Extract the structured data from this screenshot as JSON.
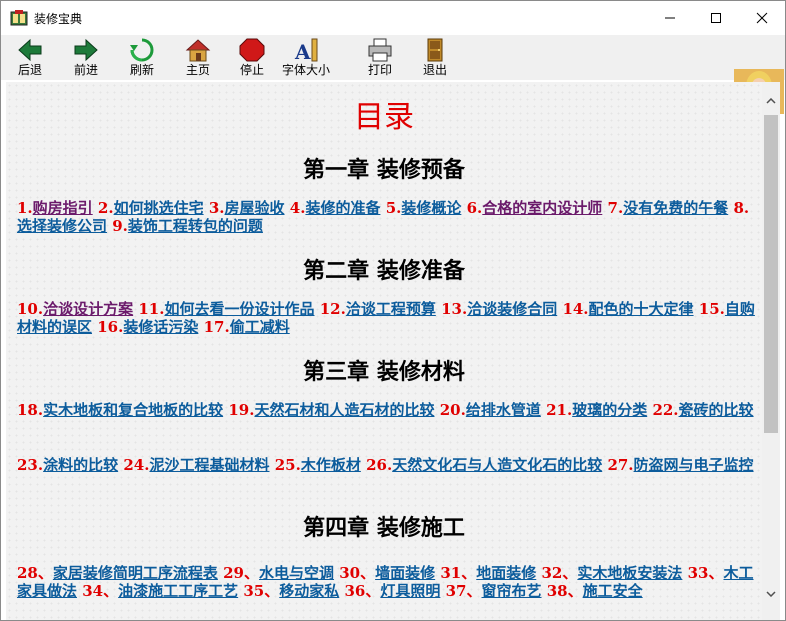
{
  "window": {
    "title": "装修宝典",
    "minimize_icon": "minimize-icon",
    "maximize_icon": "maximize-icon",
    "close_icon": "close-icon"
  },
  "toolbar": {
    "back": "后退",
    "forward": "前进",
    "refresh": "刷新",
    "home": "主页",
    "stop": "停止",
    "font_size": "字体大小",
    "print": "打印",
    "exit": "退出"
  },
  "colors": {
    "link": "#0c5c9c",
    "visited_link": "#6b1a6b",
    "number": "#e00000",
    "title": "#e00000"
  },
  "content": {
    "title": "目录",
    "chapters": [
      {
        "heading": "第一章 装修预备",
        "items": [
          {
            "num": "1.",
            "text": "购房指引",
            "visited": true
          },
          {
            "num": "2.",
            "text": "如何挑选住宅",
            "visited": false
          },
          {
            "num": "3.",
            "text": "房屋验收",
            "visited": false
          },
          {
            "num": "4.",
            "text": "装修的准备",
            "visited": false
          },
          {
            "num": "5.",
            "text": "装修概论",
            "visited": false
          },
          {
            "num": "6.",
            "text": "合格的室内设计师",
            "visited": true
          },
          {
            "num": "7.",
            "text": "没有免费的午餐",
            "visited": false
          },
          {
            "num": "8.",
            "text": "选择装修公司",
            "visited": false
          },
          {
            "num": "9.",
            "text": "装饰工程转包的问题",
            "visited": false
          }
        ]
      },
      {
        "heading": "第二章 装修准备",
        "items": [
          {
            "num": "10.",
            "text": "洽谈设计方案",
            "visited": true
          },
          {
            "num": "11.",
            "text": "如何去看一份设计作品",
            "visited": false
          },
          {
            "num": "12.",
            "text": "洽谈工程预算",
            "visited": false
          },
          {
            "num": "13.",
            "text": "洽谈装修合同",
            "visited": false
          },
          {
            "num": "14.",
            "text": "配色的十大定律",
            "visited": false
          },
          {
            "num": "15.",
            "text": "自购材料的误区",
            "visited": false
          },
          {
            "num": "16.",
            "text": "装修话污染",
            "visited": false
          },
          {
            "num": "17.",
            "text": "偷工减料",
            "visited": false
          }
        ]
      },
      {
        "heading": "第三章 装修材料",
        "items": [
          {
            "num": "18.",
            "text": "实木地板和复合地板的比较",
            "visited": false
          },
          {
            "num": "19.",
            "text": "天然石材和人造石材的比较",
            "visited": false
          },
          {
            "num": "20.",
            "text": "给排水管道",
            "visited": false
          },
          {
            "num": "21.",
            "text": "玻璃的分类",
            "visited": false
          },
          {
            "num": "22.",
            "text": "瓷砖的比较",
            "visited": false
          }
        ],
        "items2": [
          {
            "num": "23.",
            "text": "涂料的比较",
            "visited": false
          },
          {
            "num": "24.",
            "text": "泥沙工程基础材料",
            "visited": false
          },
          {
            "num": "25.",
            "text": "木作板材",
            "visited": false
          },
          {
            "num": "26.",
            "text": "天然文化石与人造文化石的比较",
            "visited": false
          },
          {
            "num": "27.",
            "text": "防盗网与电子监控",
            "visited": false
          }
        ]
      },
      {
        "heading": "第四章 装修施工",
        "items": [
          {
            "num": "28、",
            "text": "家居装修简明工序流程表",
            "visited": false
          },
          {
            "num": "29、",
            "text": "水电与空调",
            "visited": false
          },
          {
            "num": "30、",
            "text": "墙面装修",
            "visited": false
          },
          {
            "num": "31、",
            "text": "地面装修",
            "visited": false
          },
          {
            "num": "32、",
            "text": "实木地板安装法",
            "visited": false
          },
          {
            "num": "33、",
            "text": "木工家具做法",
            "visited": false
          },
          {
            "num": "34、",
            "text": "油漆施工工序工艺",
            "visited": false
          },
          {
            "num": "35、",
            "text": "移动家私",
            "visited": false
          },
          {
            "num": "36、",
            "text": "灯具照明",
            "visited": false
          },
          {
            "num": "37、",
            "text": "窗帘布艺",
            "visited": false
          },
          {
            "num": "38、",
            "text": "施工安全",
            "visited": false
          }
        ]
      }
    ]
  }
}
